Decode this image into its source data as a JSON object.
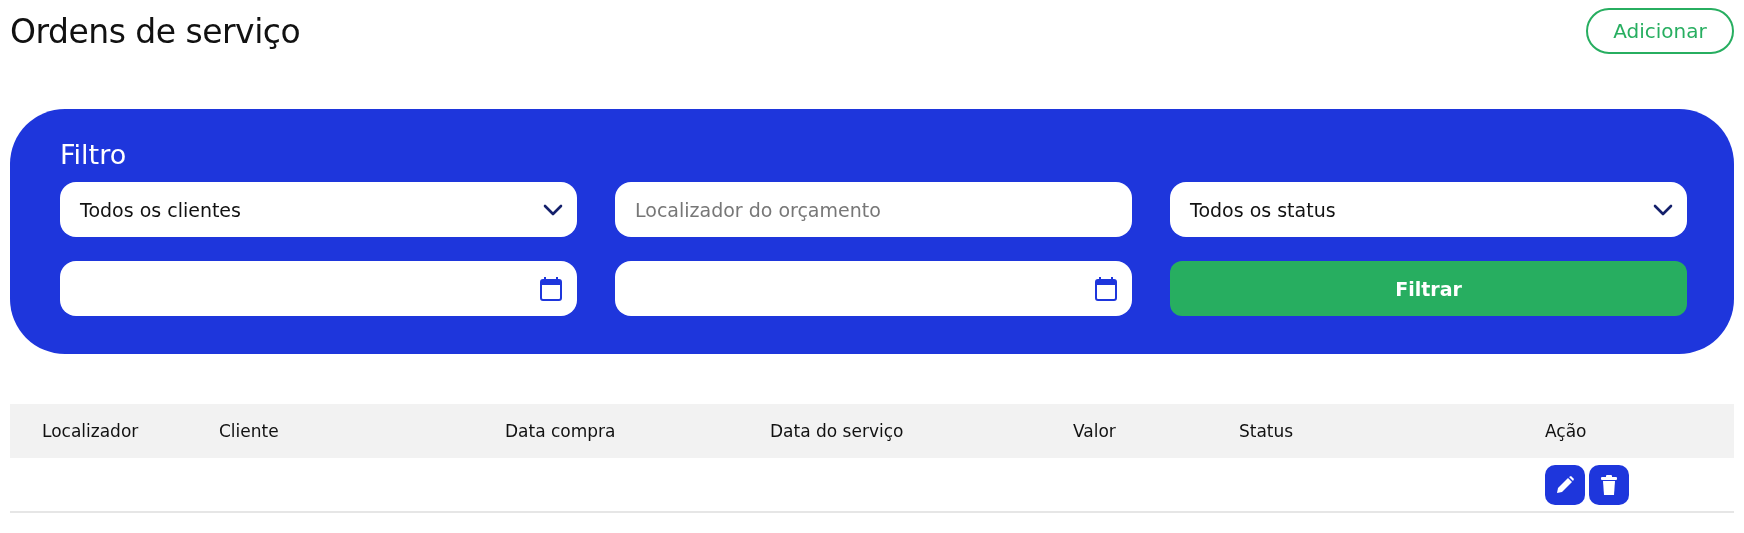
{
  "page_title": "Ordens de serviço",
  "add_button": "Adicionar",
  "filter": {
    "title": "Filtro",
    "fields": [
      {
        "kind": "select",
        "value": "Todos os clientes"
      },
      {
        "kind": "text",
        "placeholder": "Localizador do orçamento"
      },
      {
        "kind": "select",
        "value": "Todos os status"
      },
      {
        "kind": "date"
      },
      {
        "kind": "date"
      }
    ],
    "button": "Filtrar"
  },
  "table": {
    "columns": [
      "Localizador",
      "Cliente",
      "Data compra",
      "Data do serviço",
      "Valor",
      "Status",
      "Ação"
    ],
    "rows": [
      {
        "actions": [
          {
            "kind": "edit"
          },
          {
            "kind": "delete"
          }
        ]
      }
    ]
  }
}
